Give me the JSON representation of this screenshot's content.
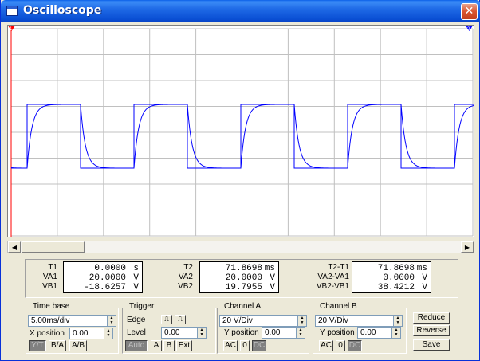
{
  "window": {
    "title": "Oscilloscope"
  },
  "cursors": {
    "t1_marker": "1",
    "t2_marker": "2"
  },
  "readout": {
    "group1": {
      "labels": [
        "T1",
        "VA1",
        "VB1"
      ],
      "rows": [
        [
          "0.0000",
          "s"
        ],
        [
          "20.0000",
          "V"
        ],
        [
          "-18.6257",
          "V"
        ]
      ]
    },
    "group2": {
      "labels": [
        "T2",
        "VA2",
        "VB2"
      ],
      "rows": [
        [
          "71.8698",
          "ms"
        ],
        [
          "20.0000",
          "V"
        ],
        [
          "19.7955",
          "V"
        ]
      ]
    },
    "group3": {
      "labels": [
        "T2-T1",
        "VA2-VA1",
        "VB2-VB1"
      ],
      "rows": [
        [
          "71.8698",
          "ms"
        ],
        [
          "0.0000",
          "V"
        ],
        [
          "38.4212",
          "V"
        ]
      ]
    }
  },
  "timebase": {
    "legend": "Time base",
    "value": "5.00ms/div",
    "xpos_label": "X position",
    "xpos_value": "0.00",
    "modes": [
      "Y/T",
      "B/A",
      "A/B"
    ]
  },
  "trigger": {
    "legend": "Trigger",
    "edge_label": "Edge",
    "level_label": "Level",
    "level_value": "0.00",
    "modes": [
      "Auto",
      "A",
      "B",
      "Ext"
    ]
  },
  "channel_a": {
    "legend": "Channel A",
    "value": "20 V/Div",
    "ypos_label": "Y position",
    "ypos_value": "0.00",
    "coupling": [
      "AC",
      "0",
      "DC"
    ]
  },
  "channel_b": {
    "legend": "Channel B",
    "value": "20 V/Div",
    "ypos_label": "Y position",
    "ypos_value": "0.00",
    "coupling": [
      "AC",
      "0",
      "DC"
    ]
  },
  "actions": {
    "reduce": "Reduce",
    "reverse": "Reverse",
    "save": "Save"
  },
  "colors": {
    "trace": "#0000ff",
    "grid": "#c0c0c0",
    "cursor1": "#ff0000",
    "cursor2": "#0000ff"
  }
}
